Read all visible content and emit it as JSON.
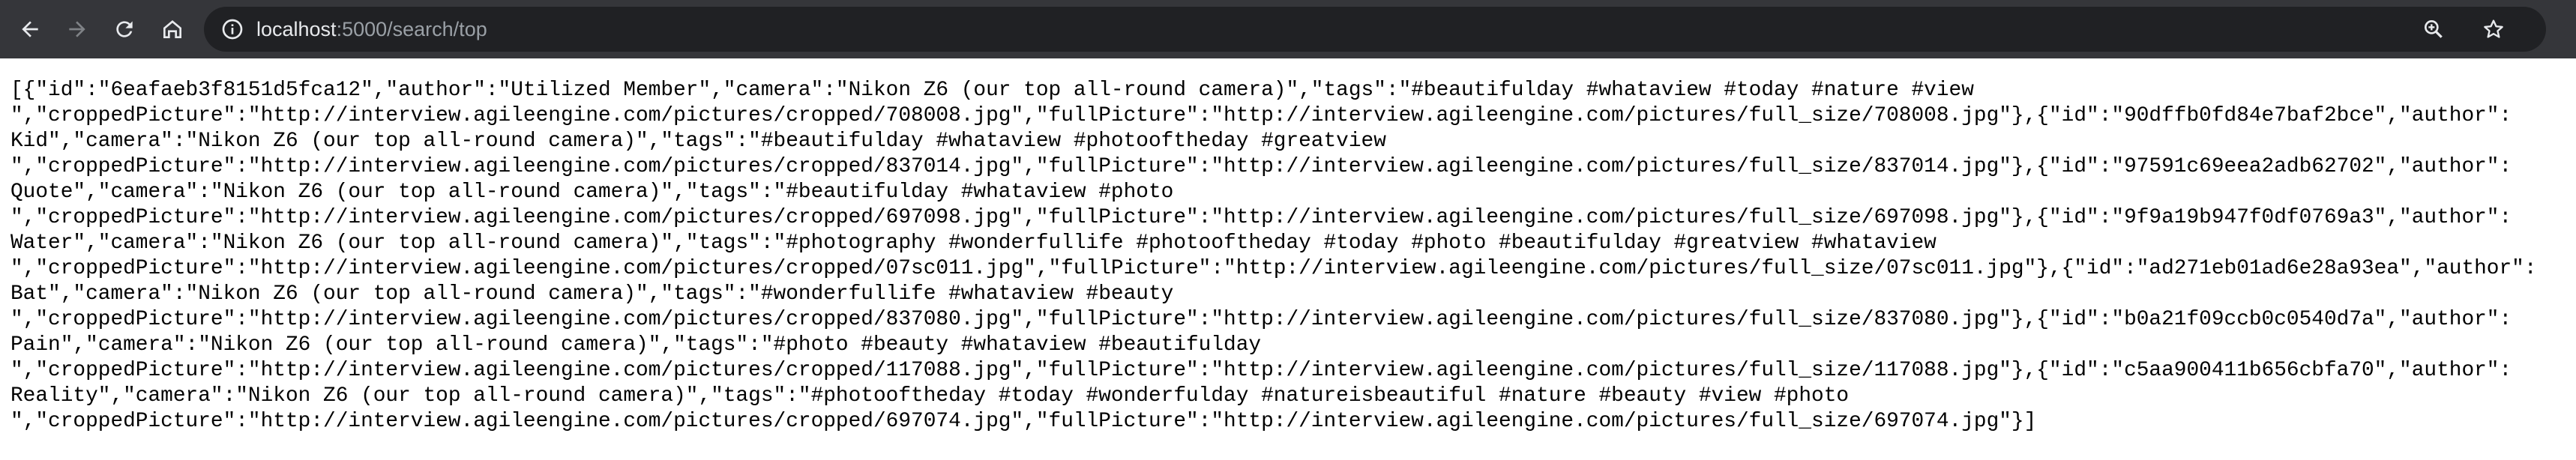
{
  "browser": {
    "url_host": "localhost",
    "url_path": ":5000/search/top",
    "icons": [
      "back-arrow-icon",
      "forward-arrow-icon",
      "reload-icon",
      "home-icon",
      "info-icon",
      "zoom-icon",
      "star-icon"
    ],
    "colors": {
      "toolbar_bg": "#35363a",
      "omnibox_bg": "#202124",
      "url_host": "#e8eaed",
      "url_path": "#9aa0a6"
    }
  },
  "page": {
    "lines": [
      "[{\"id\":\"6eafaeb3f8151d5fca12\",\"author\":\"Utilized Member\",\"camera\":\"Nikon Z6 (our top all-round camera)\",\"tags\":\"#beautifulday #whataview #today #nature #view",
      "\",\"croppedPicture\":\"http://interview.agileengine.com/pictures/cropped/708008.jpg\",\"fullPicture\":\"http://interview.agileengine.com/pictures/full_size/708008.jpg\"},{\"id\":\"90dffb0fd84e7baf2bce\",\"author\":",
      "Kid\",\"camera\":\"Nikon Z6 (our top all-round camera)\",\"tags\":\"#beautifulday #whataview #photooftheday #greatview",
      "\",\"croppedPicture\":\"http://interview.agileengine.com/pictures/cropped/837014.jpg\",\"fullPicture\":\"http://interview.agileengine.com/pictures/full_size/837014.jpg\"},{\"id\":\"97591c69eea2adb62702\",\"author\":",
      "Quote\",\"camera\":\"Nikon Z6 (our top all-round camera)\",\"tags\":\"#beautifulday #whataview #photo",
      "\",\"croppedPicture\":\"http://interview.agileengine.com/pictures/cropped/697098.jpg\",\"fullPicture\":\"http://interview.agileengine.com/pictures/full_size/697098.jpg\"},{\"id\":\"9f9a19b947f0df0769a3\",\"author\":",
      "Water\",\"camera\":\"Nikon Z6 (our top all-round camera)\",\"tags\":\"#photography #wonderfullife #photooftheday #today #photo #beautifulday #greatview #whataview",
      "\",\"croppedPicture\":\"http://interview.agileengine.com/pictures/cropped/07sc011.jpg\",\"fullPicture\":\"http://interview.agileengine.com/pictures/full_size/07sc011.jpg\"},{\"id\":\"ad271eb01ad6e28a93ea\",\"author\":",
      "Bat\",\"camera\":\"Nikon Z6 (our top all-round camera)\",\"tags\":\"#wonderfullife #whataview #beauty",
      "\",\"croppedPicture\":\"http://interview.agileengine.com/pictures/cropped/837080.jpg\",\"fullPicture\":\"http://interview.agileengine.com/pictures/full_size/837080.jpg\"},{\"id\":\"b0a21f09ccb0c0540d7a\",\"author\":",
      "Pain\",\"camera\":\"Nikon Z6 (our top all-round camera)\",\"tags\":\"#photo #beauty #whataview #beautifulday",
      "\",\"croppedPicture\":\"http://interview.agileengine.com/pictures/cropped/117088.jpg\",\"fullPicture\":\"http://interview.agileengine.com/pictures/full_size/117088.jpg\"},{\"id\":\"c5aa900411b656cbfa70\",\"author\":",
      "Reality\",\"camera\":\"Nikon Z6 (our top all-round camera)\",\"tags\":\"#photooftheday #today #wonderfulday #natureisbeautiful #nature #beauty #view #photo",
      "\",\"croppedPicture\":\"http://interview.agileengine.com/pictures/cropped/697074.jpg\",\"fullPicture\":\"http://interview.agileengine.com/pictures/full_size/697074.jpg\"}]"
    ]
  }
}
